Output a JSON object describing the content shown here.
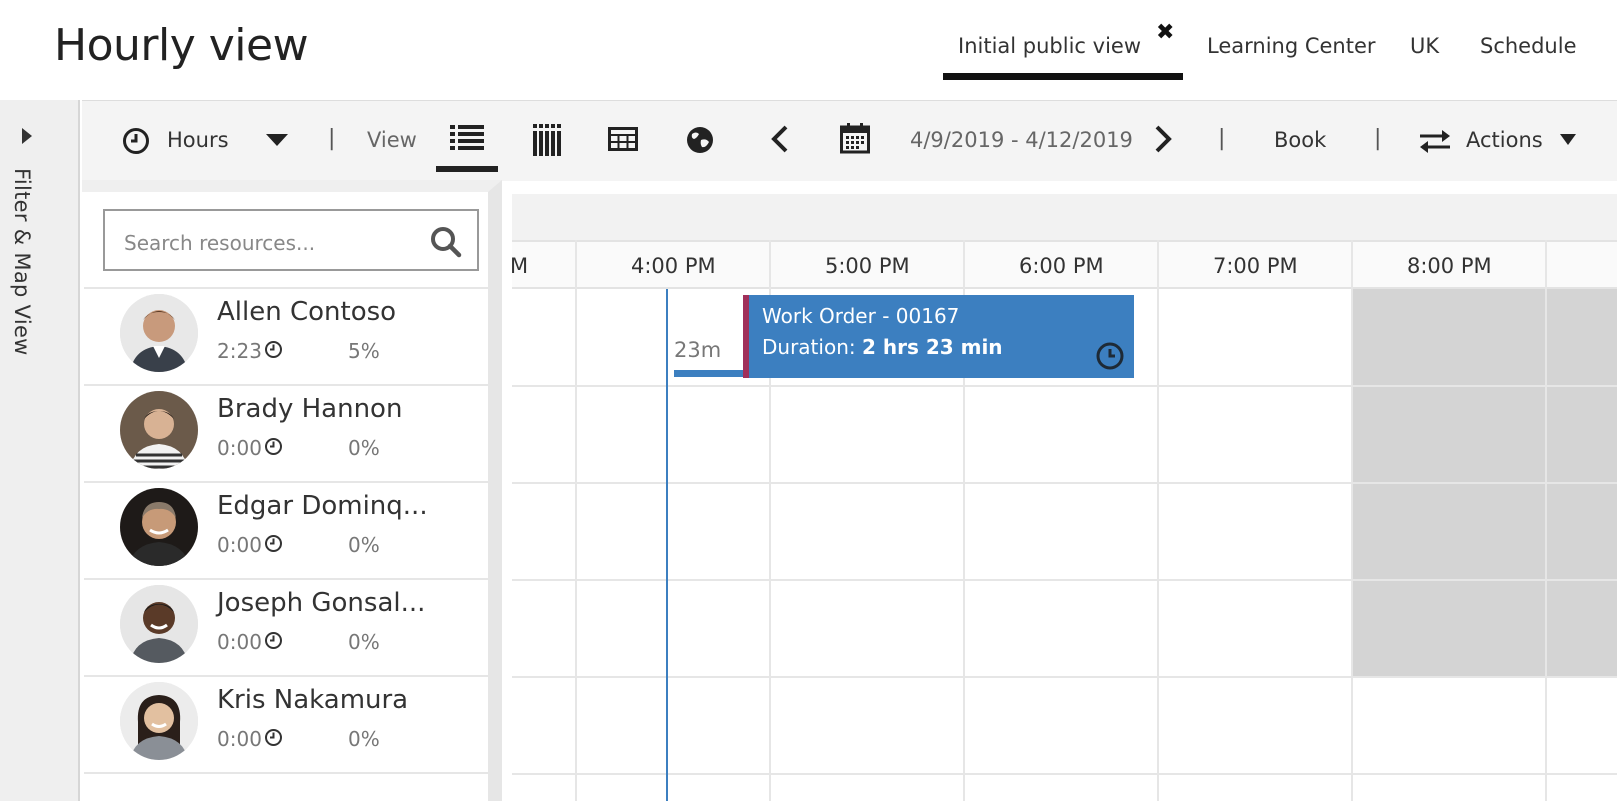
{
  "header": {
    "title": "Hourly view",
    "tabs": [
      {
        "label": "Initial public view",
        "active": true
      },
      {
        "label": "Learning Center"
      },
      {
        "label": "UK"
      },
      {
        "label": "Schedule"
      }
    ]
  },
  "side_rail": {
    "label": "Filter & Map View"
  },
  "toolbar": {
    "timescale": "Hours",
    "view_label": "View",
    "date_range": "4/9/2019 - 4/12/2019",
    "book": "Book",
    "actions": "Actions",
    "separator": "|"
  },
  "search": {
    "placeholder": "Search resources..."
  },
  "resources": [
    {
      "name": "Allen Contoso",
      "hours": "2:23",
      "percent": "5%"
    },
    {
      "name": "Brady Hannon",
      "hours": "0:00",
      "percent": "0%"
    },
    {
      "name": "Edgar Dominq...",
      "hours": "0:00",
      "percent": "0%"
    },
    {
      "name": "Joseph Gonsal...",
      "hours": "0:00",
      "percent": "0%"
    },
    {
      "name": "Kris Nakamura",
      "hours": "0:00",
      "percent": "0%"
    }
  ],
  "timeline": {
    "partial_label": "M",
    "hours": [
      "4:00 PM",
      "5:00 PM",
      "6:00 PM",
      "7:00 PM",
      "8:00 PM"
    ]
  },
  "booking": {
    "title": "Work Order - 00167",
    "duration_prefix": "Duration: ",
    "duration": "2 hrs 23 min",
    "travel": "23m"
  },
  "colors": {
    "booking": "#3c7fc0",
    "booking_accent": "#a0305a",
    "off_hours": "#d4d4d4",
    "now_line": "#3c7fc0"
  }
}
